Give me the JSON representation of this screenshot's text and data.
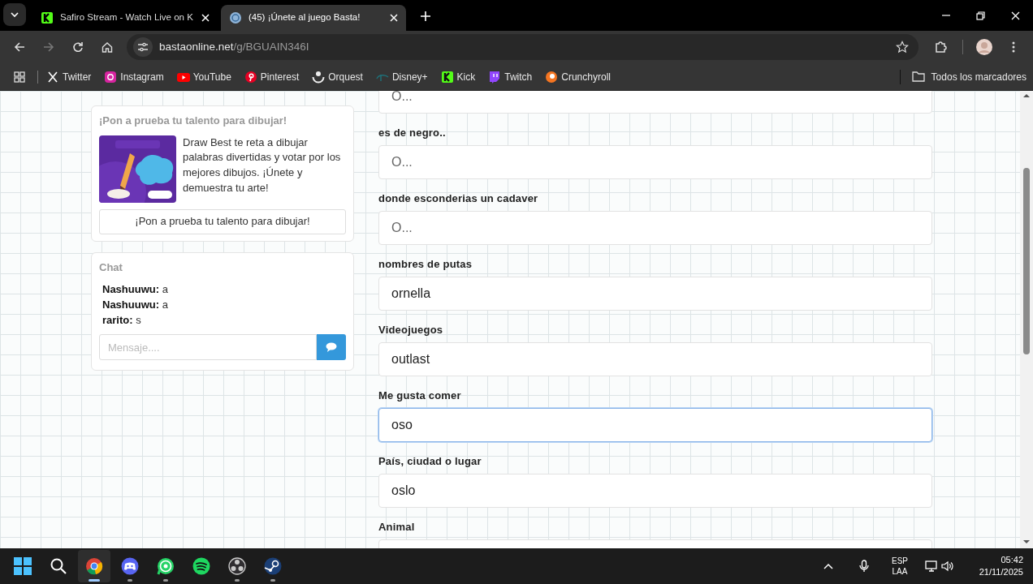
{
  "browser": {
    "tabs": [
      {
        "title": "Safiro Stream - Watch Live on K",
        "selected": false
      },
      {
        "title": "(45) ¡Únete al juego Basta!",
        "selected": true
      }
    ],
    "address": {
      "host": "bastaonline.net",
      "path": "/g/BGUAIN346I"
    },
    "bookmarks": [
      {
        "label": "Twitter"
      },
      {
        "label": "Instagram"
      },
      {
        "label": "YouTube"
      },
      {
        "label": "Pinterest"
      },
      {
        "label": "Orquest"
      },
      {
        "label": "Disney+"
      },
      {
        "label": "Kick"
      },
      {
        "label": "Twitch"
      },
      {
        "label": "Crunchyroll"
      }
    ],
    "all_bookmarks": "Todos los marcadores"
  },
  "page": {
    "promo": {
      "heading": "¡Pon a prueba tu talento para dibujar!",
      "description": "Draw Best te reta a dibujar palabras divertidas y votar por los mejores dibujos. ¡Únete y demuestra tu arte!",
      "button": "¡Pon a prueba tu talento para dibujar!"
    },
    "chat": {
      "title": "Chat",
      "messages": [
        {
          "user": "Nashuuwu:",
          "text": "a"
        },
        {
          "user": "Nashuuwu:",
          "text": "a"
        },
        {
          "user": "rarito:",
          "text": "s"
        }
      ],
      "placeholder": "Mensaje...."
    },
    "fields": [
      {
        "placeholder": "O...",
        "focused": false
      },
      {
        "label": "es de negro..",
        "placeholder": "O...",
        "focused": false
      },
      {
        "label": "donde esconderias un cadaver",
        "placeholder": "O...",
        "focused": false
      },
      {
        "label": "nombres de putas",
        "value": "ornella",
        "focused": false
      },
      {
        "label": "Videojuegos",
        "value": "outlast",
        "focused": false
      },
      {
        "label": "Me gusta comer",
        "value": "oso",
        "focused": true
      },
      {
        "label": "País, ciudad o lugar",
        "value": "oslo",
        "focused": false
      },
      {
        "label": "Animal",
        "focused": false
      }
    ]
  },
  "taskbar": {
    "apps": [
      {
        "running": true,
        "selected": true
      },
      {
        "running": true,
        "selected": false
      },
      {
        "running": true,
        "selected": false
      },
      {
        "running": false,
        "selected": false
      },
      {
        "running": true,
        "selected": false
      },
      {
        "running": true,
        "selected": false
      }
    ],
    "language": "ESP",
    "layout": "LAA",
    "time": "05:42",
    "date": "21/11/2025"
  }
}
